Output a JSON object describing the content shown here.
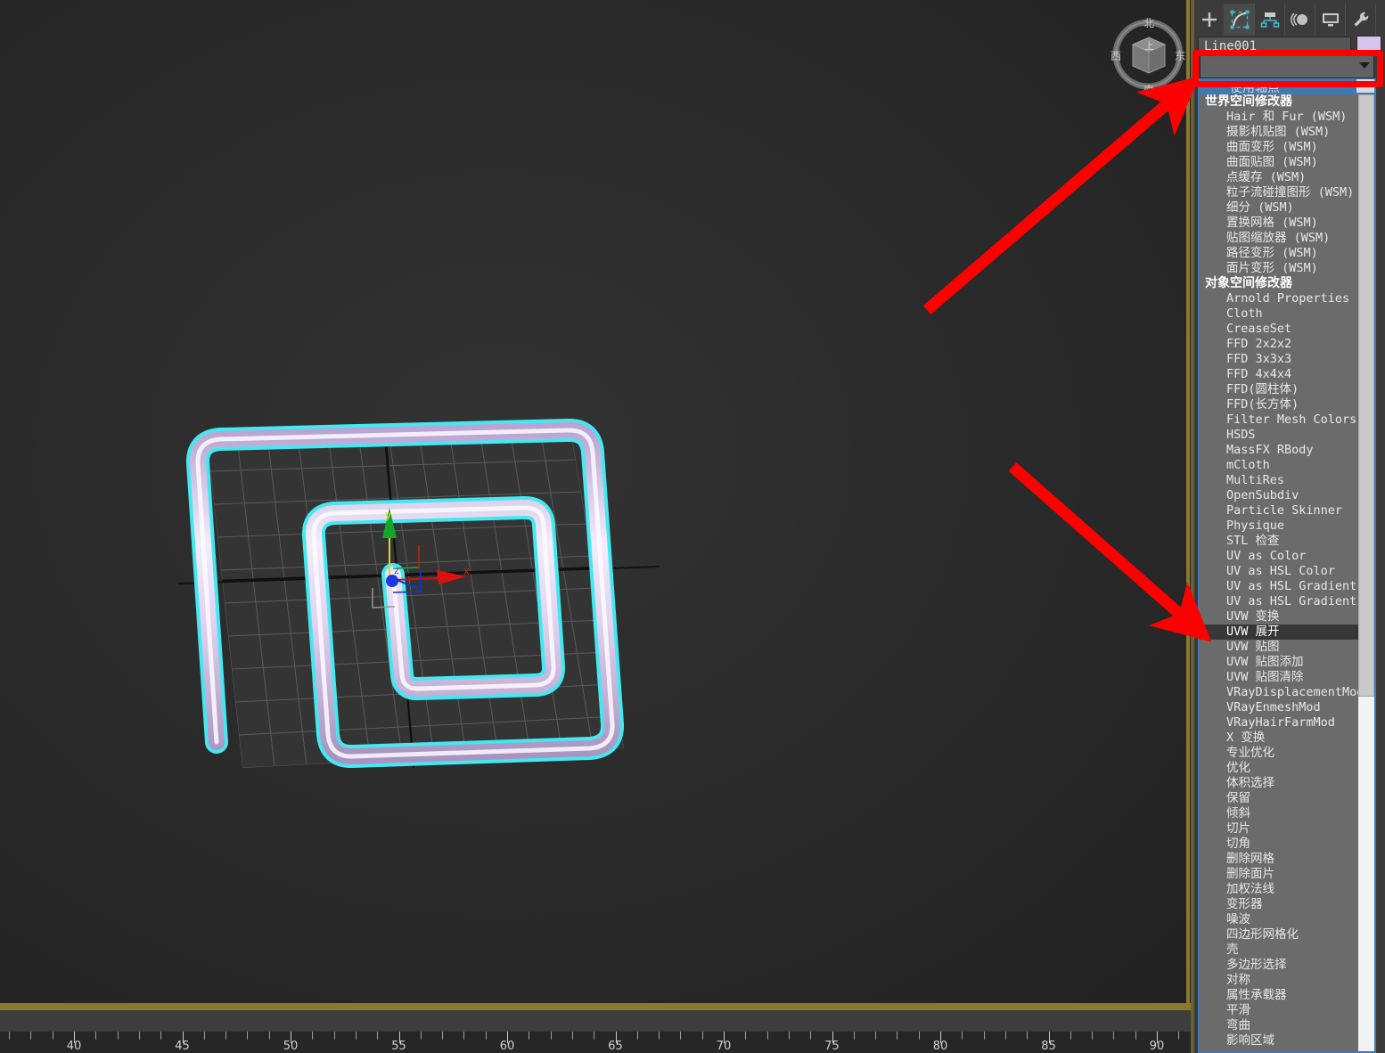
{
  "app": {
    "viewport": {
      "name": "perspective-viewport",
      "object_name": "Line001",
      "gizmo_axes": [
        "x",
        "y",
        "z"
      ],
      "axis_colors": {
        "x": "#dd2222",
        "y": "#22bb33",
        "z": "#2244ee"
      },
      "selection_color": "#44e8f0",
      "object_color": "#e3d4f2"
    },
    "viewcube": {
      "top_label": "上",
      "north": "北",
      "south": "南",
      "west": "西",
      "east": "东"
    }
  },
  "timeline": {
    "tick_labels": [
      "40",
      "45",
      "50",
      "55",
      "60",
      "65",
      "70",
      "75",
      "80",
      "85",
      "90"
    ]
  },
  "command_panel": {
    "tabs": [
      {
        "name": "create",
        "icon": "plus-icon",
        "active": false
      },
      {
        "name": "modify",
        "icon": "modify-curve-icon",
        "active": true
      },
      {
        "name": "hierarchy",
        "icon": "hierarchy-icon",
        "active": false
      },
      {
        "name": "motion",
        "icon": "motion-circles-icon",
        "active": false
      },
      {
        "name": "display",
        "icon": "display-monitor-icon",
        "active": false
      },
      {
        "name": "utilities",
        "icon": "wrench-icon",
        "active": false
      }
    ],
    "object_name": "Line001",
    "object_color": "#d8c3ee",
    "modifier_dropdown_value": "",
    "pivot_row_label": "使用轴点",
    "selected_modifier": "UVW 展开"
  },
  "modifier_list": {
    "sections": [
      {
        "header": "世界空间修改器",
        "items": [
          "Hair 和 Fur (WSM)",
          "摄影机贴图 (WSM)",
          "曲面变形 (WSM)",
          "曲面贴图 (WSM)",
          "点缓存 (WSM)",
          "粒子流碰撞图形 (WSM)",
          "细分 (WSM)",
          "置换网格 (WSM)",
          "贴图缩放器 (WSM)",
          "路径变形 (WSM)",
          "面片变形 (WSM)"
        ]
      },
      {
        "header": "对象空间修改器",
        "items": [
          "Arnold Properties",
          "Cloth",
          "CreaseSet",
          "FFD 2x2x2",
          "FFD 3x3x3",
          "FFD 4x4x4",
          "FFD(圆柱体)",
          "FFD(长方体)",
          "Filter Mesh Colors By Hue",
          "HSDS",
          "MassFX RBody",
          "mCloth",
          "MultiRes",
          "OpenSubdiv",
          "Particle Skinner",
          "Physique",
          "STL 检查",
          "UV as Color",
          "UV as HSL Color",
          "UV as HSL Gradient",
          "UV as HSL Gradient With Mi",
          "UVW 变换",
          "UVW 展开",
          "UVW 贴图",
          "UVW 贴图添加",
          "UVW 贴图清除",
          "VRayDisplacementMod",
          "VRayEnmeshMod",
          "VRayHairFarmMod",
          "X 变换",
          "专业优化",
          "优化",
          "体积选择",
          "保留",
          "倾斜",
          "切片",
          "切角",
          "删除网格",
          "删除面片",
          "加权法线",
          "变形器",
          "噪波",
          "四边形网格化",
          "壳",
          "多边形选择",
          "对称",
          "属性承载器",
          "平滑",
          "弯曲",
          "影响区域"
        ]
      }
    ]
  },
  "annotations": {
    "highlight_color": "#ff0000",
    "arrow_to_dropdown": "modifier-dropdown",
    "arrow_to_modifier": "UVW 展开"
  }
}
